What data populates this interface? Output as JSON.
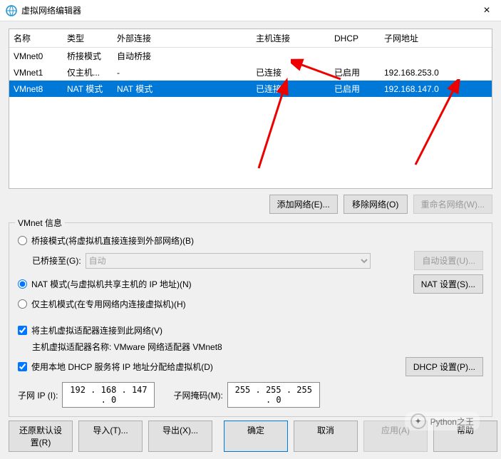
{
  "window": {
    "title": "虚拟网络编辑器",
    "close": "×"
  },
  "table": {
    "headers": [
      "名称",
      "类型",
      "外部连接",
      "主机连接",
      "DHCP",
      "子网地址"
    ],
    "rows": [
      {
        "name": "VMnet0",
        "type": "桥接模式",
        "ext": "自动桥接",
        "host": "",
        "dhcp": "",
        "subnet": ""
      },
      {
        "name": "VMnet1",
        "type": "仅主机...",
        "ext": "-",
        "host": "已连接",
        "dhcp": "已启用",
        "subnet": "192.168.253.0"
      },
      {
        "name": "VMnet8",
        "type": "NAT 模式",
        "ext": "NAT 模式",
        "host": "已连接",
        "dhcp": "已启用",
        "subnet": "192.168.147.0"
      }
    ]
  },
  "buttons": {
    "add_net": "添加网络(E)...",
    "remove_net": "移除网络(O)",
    "rename_net": "重命名网络(W)..."
  },
  "group": {
    "title": "VMnet 信息",
    "radio_bridge": "桥接模式(将虚拟机直接连接到外部网络)(B)",
    "bridge_to_label": "已桥接至(G):",
    "bridge_select": "自动",
    "auto_settings": "自动设置(U)...",
    "radio_nat": "NAT 模式(与虚拟机共享主机的 IP 地址)(N)",
    "nat_settings": "NAT 设置(S)...",
    "radio_hostonly": "仅主机模式(在专用网络内连接虚拟机)(H)",
    "cb_host_adapter": "将主机虚拟适配器连接到此网络(V)",
    "host_adapter_name": "主机虚拟适配器名称: VMware 网络适配器 VMnet8",
    "cb_dhcp": "使用本地 DHCP 服务将 IP 地址分配给虚拟机(D)",
    "dhcp_settings": "DHCP 设置(P)..."
  },
  "ip": {
    "subnet_ip_label": "子网 IP (I):",
    "subnet_ip": "192 . 168 . 147 .  0",
    "mask_label": "子网掩码(M):",
    "mask": "255 . 255 . 255 .  0"
  },
  "footer": {
    "restore": "还原默认设置(R)",
    "import": "导入(T)...",
    "export": "导出(X)...",
    "ok": "确定",
    "cancel": "取消",
    "apply": "应用(A)",
    "help": "帮助"
  },
  "watermark": "Python之王"
}
